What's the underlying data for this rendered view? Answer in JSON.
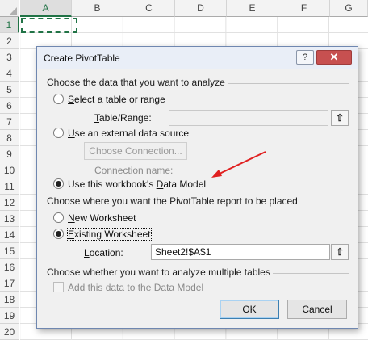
{
  "sheet": {
    "columns": [
      "A",
      "B",
      "C",
      "D",
      "E",
      "F",
      "G"
    ],
    "rows": [
      "1",
      "2",
      "3",
      "4",
      "5",
      "6",
      "7",
      "8",
      "9",
      "10",
      "11",
      "12",
      "13",
      "14",
      "15",
      "16",
      "17",
      "18",
      "19",
      "20"
    ],
    "selected_column": "A",
    "selected_row": "1"
  },
  "dialog": {
    "title": "Create PivotTable",
    "help_icon": "?",
    "close_icon": "✕",
    "section1_label": "Choose the data that you want to analyze",
    "option_select_table": {
      "underline": "S",
      "rest": "elect a table or range"
    },
    "table_range_label": {
      "underline": "T",
      "rest": "able/Range:"
    },
    "table_range_value": "",
    "picker_icon": "⇧",
    "option_external": {
      "underline": "U",
      "rest": "se an external data source"
    },
    "choose_connection_label": "Choose Connection...",
    "connection_name_label": "Connection name:",
    "option_data_model": {
      "pre": "Use this workbook's ",
      "underline": "D",
      "rest": "ata Model"
    },
    "section2_label": "Choose where you want the PivotTable report to be placed",
    "option_new_ws": {
      "underline": "N",
      "rest": "ew Worksheet"
    },
    "option_existing_ws": {
      "underline": "E",
      "rest": "xisting Worksheet"
    },
    "location_label": {
      "underline": "L",
      "rest": "ocation:"
    },
    "location_value": "Sheet2!$A$1",
    "section3_label": "Choose whether you want to analyze multiple tables",
    "add_data_model_label": "Add this data to the Data Model",
    "ok_label": "OK",
    "cancel_label": "Cancel"
  },
  "colors": {
    "excel_green": "#217346",
    "arrow_red": "#e02020"
  }
}
